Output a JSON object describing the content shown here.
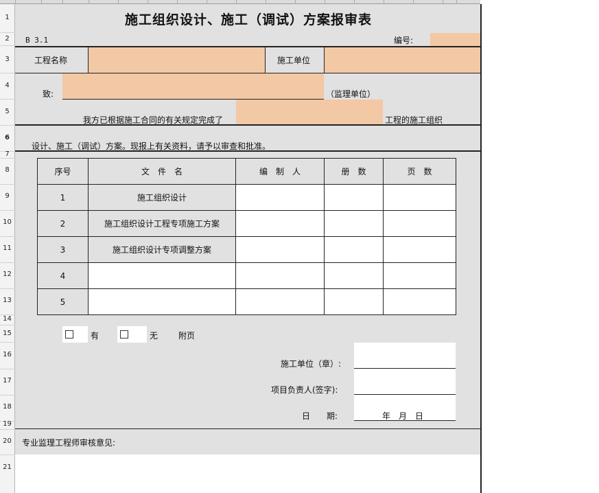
{
  "sheet": {
    "title": "施工组织设计、施工（调试）方案报审表",
    "form_code": "B 3.1",
    "number_label": "编号:",
    "project_name_label": "工程名称",
    "construction_unit_label": "施工单位",
    "to_label": "致:",
    "supervision_unit_suffix": "（监理单位）",
    "body_line1_prefix": "我方已根据施工合同的有关规定完成了",
    "body_line1_suffix": "工程的施工组织",
    "body_line2": "设计、施工（调试）方案。现报上有关资料，请予以审查和批准。",
    "table": {
      "headers": [
        "序号",
        "文　件　名",
        "编　制　人",
        "册　数",
        "页　数"
      ],
      "rows": [
        {
          "no": "1",
          "name": "施工组织设计"
        },
        {
          "no": "2",
          "name": "施工组织设计工程专项施工方案"
        },
        {
          "no": "3",
          "name": "施工组织设计专项调整方案"
        },
        {
          "no": "4",
          "name": ""
        },
        {
          "no": "5",
          "name": ""
        }
      ]
    },
    "attach_yes": "有",
    "attach_no": "无",
    "attach_label": "附页",
    "sign_unit_label": "施工单位（章）:",
    "sign_person_label": "项目负责人(签字):",
    "sign_date_label": "日　　期:",
    "sign_date_value": "年　月　日",
    "review_label": "专业监理工程师审核意见:"
  },
  "row_numbers": [
    "1",
    "2",
    "3",
    "4",
    "5",
    "6",
    "7",
    "8",
    "9",
    "10",
    "11",
    "12",
    "13",
    "14",
    "15",
    "16",
    "17",
    "18",
    "19",
    "20",
    "21"
  ],
  "colors": {
    "input_fill": "#f3c8a5",
    "sheet_gray": "#e1e1e1"
  }
}
